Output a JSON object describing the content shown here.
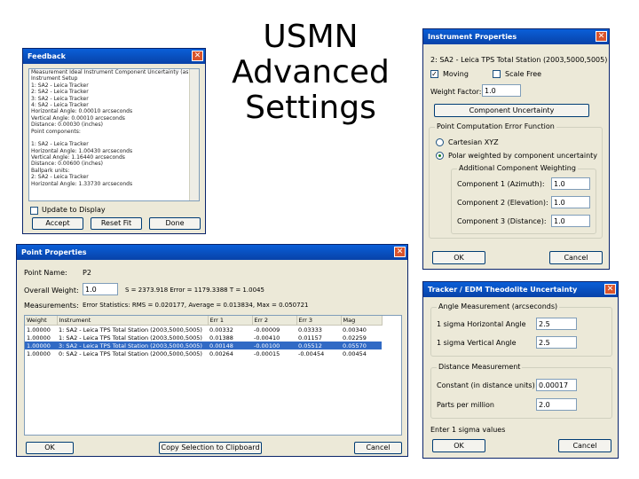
{
  "slide": {
    "title": "USMN\nAdvanced\nSettings"
  },
  "feedback": {
    "title": "Feedback",
    "lines": [
      "Measurement Ideal Instrument Component Uncertainty (as magnitude)",
      "Instrument Setup",
      "  1: SA2 - Leica Tracker",
      "  2: SA2 - Leica Tracker",
      "  3: SA2 - Leica Tracker",
      "  4: SA2 - Leica Tracker",
      "    Horizontal Angle: 0.00010 arcseconds",
      "    Vertical Angle: 0.00010 arcseconds",
      "    Distance: 0.00030 (inches)",
      "  Point components:",
      "",
      "1: SA2 - Leica Tracker",
      "  Horizontal Angle: 1.00430 arcseconds",
      "  Vertical Angle: 1.16440 arcseconds",
      "  Distance: 0.00600 (inches)",
      "  Ballpark units:",
      "2: SA2 - Leica Tracker",
      "  Horizontal Angle: 1.33730 arcseconds"
    ],
    "option_label": "Update to Display",
    "buttons": [
      "Accept",
      "Reset Fit",
      "Done"
    ]
  },
  "instrument": {
    "title": "Instrument Properties",
    "name_line": "2: SA2 - Leica TPS Total Station (2003,5000,5005)",
    "moving_label": "Moving",
    "moving_checked": true,
    "scale_free_label": "Scale Free",
    "scale_free_checked": false,
    "weight_factor_label": "Weight Factor:",
    "weight_factor_value": "1.0",
    "component_button": "Component Uncertainty",
    "group_label": "Point Computation Error Function",
    "radio1": "Cartesian XYZ",
    "radio2": "Polar weighted by component uncertainty",
    "subgroup_label": "Additional Component Weighting",
    "components": [
      {
        "label": "Component 1 (Azimuth):",
        "value": "1.0"
      },
      {
        "label": "Component 2 (Elevation):",
        "value": "1.0"
      },
      {
        "label": "Component 3 (Distance):",
        "value": "1.0"
      }
    ],
    "ok": "OK",
    "cancel": "Cancel"
  },
  "point": {
    "title": "Point Properties",
    "point_name_label": "Point Name:",
    "point_name_value": "P2",
    "overall_weight_label": "Overall Weight:",
    "overall_weight_value": "1.0",
    "weight_info": "S = 2373.918   Error = 1179.3388   T = 1.0045",
    "measurements_label": "Measurements:",
    "stats_line": "Error Statistics: RMS = 0.020177, Average = 0.013834, Max = 0.050721",
    "columns": [
      "Weight",
      "Instrument",
      "Err 1",
      "Err 2",
      "Err 3",
      "Mag"
    ],
    "rows": [
      [
        "1.00000",
        "1: SA2 - Leica TPS Total Station (2003,5000,5005)",
        "0.00332",
        "-0.00009",
        "0.03333",
        "0.00340"
      ],
      [
        "1.00000",
        "1: SA2 - Leica TPS Total Station (2003,5000,5005)",
        "0.01388",
        "-0.00410",
        "0.01157",
        "0.02259"
      ],
      [
        "1.00000",
        "3: SA2 - Leica TPS Total Station (2003,5000,5005)",
        "0.00148",
        "-0.00100",
        "0.05512",
        "0.05570"
      ],
      [
        "1.00000",
        "0: SA2 - Leica TPS Total Station (2000,5000,5005)",
        "0.00264",
        "-0.00015",
        "-0.00454",
        "0.00454"
      ]
    ],
    "selected_row": 2,
    "ok": "OK",
    "copy_button": "Copy Selection to Clipboard",
    "cancel": "Cancel"
  },
  "tracker": {
    "title": "Tracker / EDM Theodolite Uncertainty",
    "angle_group": "Angle Measurement (arcseconds)",
    "h_label": "1 sigma Horizontal Angle",
    "h_value": "2.5",
    "v_label": "1 sigma Vertical Angle",
    "v_value": "2.5",
    "dist_group": "Distance Measurement",
    "const_label": "Constant (in distance units)",
    "const_value": "0.00017",
    "ppm_label": "Parts per million",
    "ppm_value": "2.0",
    "footer": "Enter 1 sigma values",
    "ok": "OK",
    "cancel": "Cancel"
  }
}
